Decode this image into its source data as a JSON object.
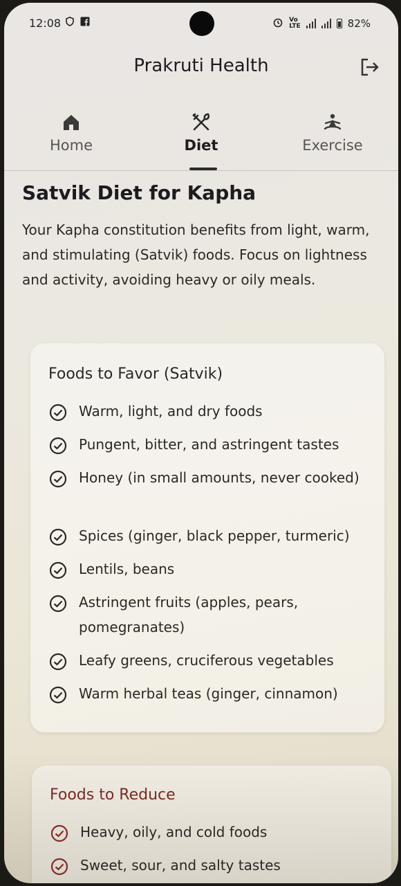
{
  "status_bar": {
    "time": "12:08",
    "battery": "82%",
    "left_icons": [
      "shield-icon",
      "facebook-icon"
    ],
    "right_icons": [
      "alarm-icon",
      "volte-icon",
      "signal-icon",
      "signal-icon",
      "battery-icon"
    ]
  },
  "app": {
    "title": "Prakruti Health"
  },
  "tabs": [
    {
      "label": "Home",
      "icon": "home-icon",
      "active": false
    },
    {
      "label": "Diet",
      "icon": "utensils-icon",
      "active": true
    },
    {
      "label": "Exercise",
      "icon": "meditation-icon",
      "active": false
    }
  ],
  "content": {
    "title": "Satvik Diet for Kapha",
    "intro": "Your Kapha constitution benefits from light, warm, and stimulating (Satvik) foods. Focus on lightness and activity, avoiding heavy or oily meals."
  },
  "favor": {
    "title": "Foods to Favor (Satvik)",
    "items": [
      "Warm, light, and dry foods",
      "Pungent, bitter, and astringent tastes",
      "Honey (in small amounts, never cooked)",
      "Spices (ginger, black pepper, turmeric)",
      "Lentils, beans",
      "Astringent fruits (apples, pears, pomegranates)",
      "Leafy greens, cruciferous vegetables",
      "Warm herbal teas (ginger, cinnamon)"
    ]
  },
  "reduce": {
    "title": "Foods to Reduce",
    "items": [
      "Heavy, oily, and cold foods",
      "Sweet, sour, and salty tastes"
    ]
  },
  "colors": {
    "favor_icon": "#2a2826",
    "reduce_icon": "#8b2c26",
    "reduce_title": "#7b2a25"
  }
}
